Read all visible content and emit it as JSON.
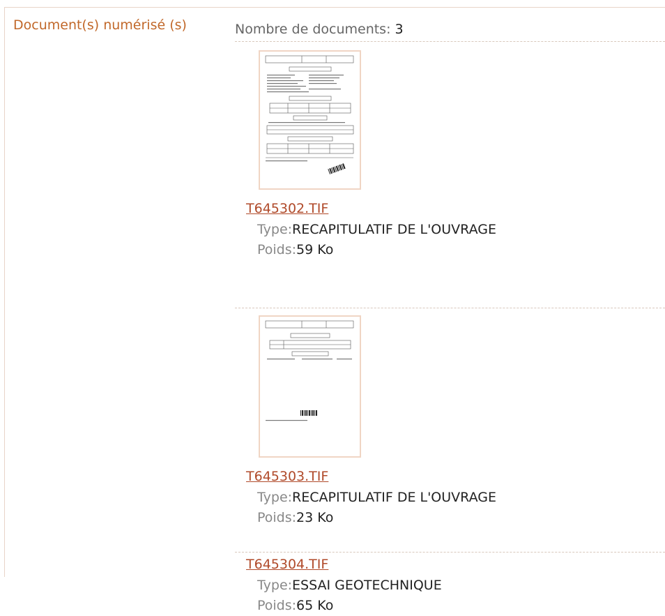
{
  "section": {
    "label": "Document(s) numérisé (s)"
  },
  "count": {
    "label": "Nombre de documents: ",
    "value": "3"
  },
  "meta_labels": {
    "type": "Type:",
    "weight": "Poids:"
  },
  "documents": [
    {
      "filename": "T645302.TIF",
      "type": "RECAPITULATIF DE L'OUVRAGE",
      "weight": "59 Ko",
      "thumbnail": "scanned-form-thumbnail"
    },
    {
      "filename": "T645303.TIF",
      "type": "RECAPITULATIF DE L'OUVRAGE",
      "weight": "23 Ko",
      "thumbnail": "scanned-form-thumbnail"
    },
    {
      "filename": "T645304.TIF",
      "type": "ESSAI GEOTECHNIQUE",
      "weight": "65 Ko"
    }
  ],
  "colors": {
    "label": "#c1682a",
    "link": "#b04a2a",
    "border": "#e8d4c8"
  }
}
